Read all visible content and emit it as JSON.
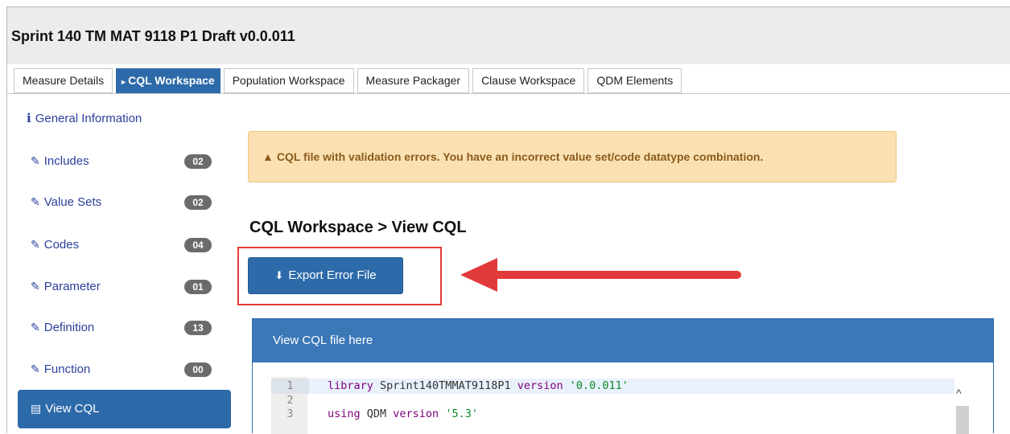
{
  "header": {
    "measure_title": "Sprint 140 TM MAT 9118 P1 Draft v0.0.011"
  },
  "tabs": [
    {
      "label": "Measure Details",
      "active": false
    },
    {
      "label": "CQL Workspace",
      "active": true
    },
    {
      "label": "Population Workspace",
      "active": false
    },
    {
      "label": "Measure Packager",
      "active": false
    },
    {
      "label": "Clause Workspace",
      "active": false
    },
    {
      "label": "QDM Elements",
      "active": false
    }
  ],
  "sidebar": {
    "general_info": "General Information",
    "items": [
      {
        "label": "Includes",
        "count": "02"
      },
      {
        "label": "Value Sets",
        "count": "02"
      },
      {
        "label": "Codes",
        "count": "04"
      },
      {
        "label": "Parameter",
        "count": "01"
      },
      {
        "label": "Definition",
        "count": "13"
      },
      {
        "label": "Function",
        "count": "00"
      }
    ],
    "view_cql": "View CQL"
  },
  "alert": {
    "message": "CQL file with validation errors. You have an incorrect value set/code datatype combination."
  },
  "main": {
    "section_title": "CQL Workspace > View CQL",
    "export_button": "Export Error File",
    "panel_title": "View CQL file here"
  },
  "editor": {
    "lines": [
      {
        "num": "1",
        "tokens": [
          "library",
          " Sprint140TMMAT9118P1 ",
          "version",
          " '0.0.011'"
        ]
      },
      {
        "num": "2",
        "tokens": [
          "",
          "",
          "",
          ""
        ]
      },
      {
        "num": "3",
        "tokens": [
          "using",
          " QDM ",
          "version",
          " '5.3'"
        ]
      }
    ]
  },
  "colors": {
    "primary": "#2d6aa9",
    "alert_bg": "#fbe1b1",
    "alert_text": "#8a5a1c",
    "badge": "#6b6b6b",
    "annotation_red": "#e23a3a",
    "link": "#2b3f9c"
  }
}
